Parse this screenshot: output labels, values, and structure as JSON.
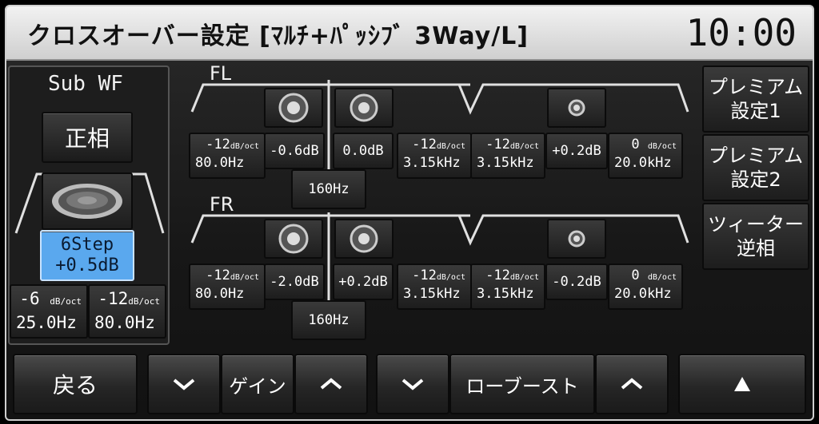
{
  "header": {
    "title": "クロスオーバー設定 [ﾏﾙﾁ+ﾊﾟｯｼﾌﾞ 3Way/L]",
    "clock": "10:00"
  },
  "subwf": {
    "label": "Sub WF",
    "phase_button": "正相",
    "gain_line1": "6Step",
    "gain_line2": "+0.5dB",
    "hpf": {
      "slope": "-6",
      "unit": "dB/oct",
      "freq": "25.0Hz"
    },
    "lpf": {
      "slope": "-12",
      "unit": "dB/oct",
      "freq": "80.0Hz"
    }
  },
  "fl": {
    "label": "FL",
    "woofer_hpf": {
      "slope": "-12",
      "unit": "dB/oct",
      "freq": "80.0Hz"
    },
    "woofer_gain": "-0.6dB",
    "mid_gain": "0.0dB",
    "mid_lpf": {
      "slope": "-12",
      "unit": "dB/oct",
      "freq": "3.15kHz"
    },
    "tweeter_hpf": {
      "slope": "-12",
      "unit": "dB/oct",
      "freq": "3.15kHz"
    },
    "tweeter_gain": "+0.2dB",
    "tweeter_lpf": {
      "slope": "0",
      "unit": "dB/oct",
      "freq": "20.0kHz"
    },
    "crossover": "160Hz"
  },
  "fr": {
    "label": "FR",
    "woofer_hpf": {
      "slope": "-12",
      "unit": "dB/oct",
      "freq": "80.0Hz"
    },
    "woofer_gain": "-2.0dB",
    "mid_gain": "+0.2dB",
    "mid_lpf": {
      "slope": "-12",
      "unit": "dB/oct",
      "freq": "3.15kHz"
    },
    "tweeter_hpf": {
      "slope": "-12",
      "unit": "dB/oct",
      "freq": "3.15kHz"
    },
    "tweeter_gain": "-0.2dB",
    "tweeter_lpf": {
      "slope": "0",
      "unit": "dB/oct",
      "freq": "20.0kHz"
    },
    "crossover": "160Hz"
  },
  "side": {
    "premium1_l1": "プレミアム",
    "premium1_l2": "設定1",
    "premium2_l1": "プレミアム",
    "premium2_l2": "設定2",
    "tweeter_l1": "ツィーター",
    "tweeter_l2": "逆相"
  },
  "bottom": {
    "back": "戻る",
    "gain": "ゲイン",
    "low_boost": "ローブースト"
  },
  "colors": {
    "highlight": "#5aa8ee",
    "text": "#ffffff",
    "title_bg": "#e4e4e4"
  }
}
